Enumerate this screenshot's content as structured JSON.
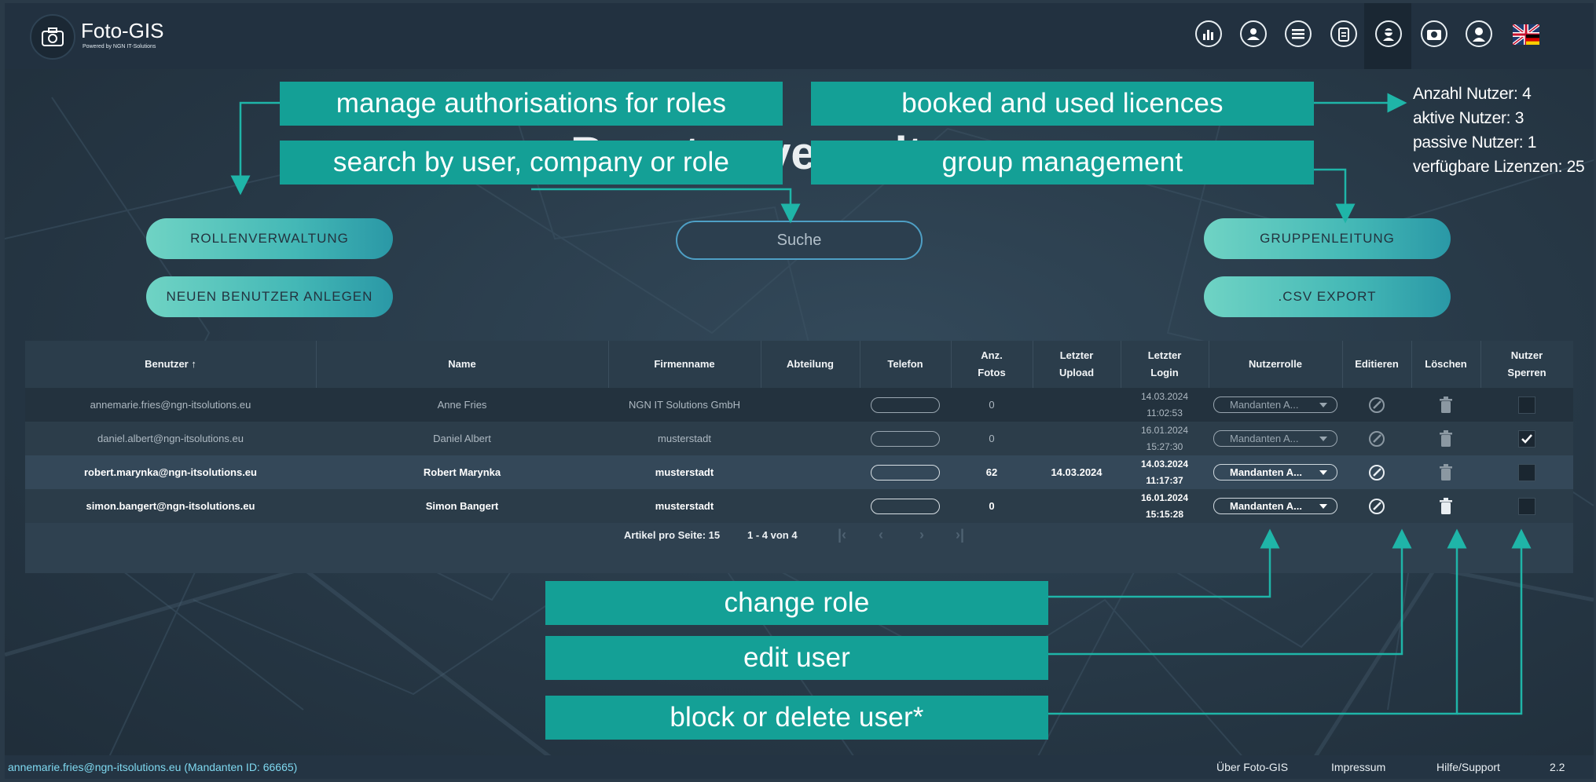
{
  "app": {
    "title": "Foto-GIS",
    "subtitle": "Powered by NGN IT-Solutions"
  },
  "nav": {
    "icons": [
      "statistics-icon",
      "map-user-icon",
      "list-icon",
      "clipboard-icon",
      "user-admin-icon",
      "camera-settings-icon",
      "profile-icon",
      "language-flag-icon"
    ]
  },
  "page": {
    "title": "Benutzerverwaltung"
  },
  "licences": {
    "line1": "Anzahl Nutzer: 4",
    "line2": "aktive Nutzer: 3",
    "line3": "passive Nutzer: 1",
    "line4": "verfügbare Lizenzen: 25"
  },
  "buttons": {
    "roles": "ROLLENVERWALTUNG",
    "new_user": "NEUEN BENUTZER ANLEGEN",
    "groups": "GRUPPENLEITUNG",
    "csv": ".CSV EXPORT"
  },
  "search": {
    "placeholder": "Suche"
  },
  "callouts": {
    "roles": "manage authorisations for roles",
    "search": "search by user, company or role",
    "licences": "booked and used licences",
    "groups": "group management",
    "change_role": "change role",
    "edit_user": "edit user",
    "block_delete": "block or delete user*"
  },
  "table": {
    "headers": {
      "user": "Benutzer",
      "sort_arrow": "↑",
      "name": "Name",
      "company": "Firmenname",
      "department": "Abteilung",
      "phone": "Telefon",
      "photos_1": "Anz.",
      "photos_2": "Fotos",
      "upload_1": "Letzter",
      "upload_2": "Upload",
      "login_1": "Letzter",
      "login_2": "Login",
      "role": "Nutzerrolle",
      "edit": "Editieren",
      "delete": "Löschen",
      "block_1": "Nutzer",
      "block_2": "Sperren"
    },
    "rows": [
      {
        "email": "annemarie.fries@ngn-itsolutions.eu",
        "name": "Anne Fries",
        "company": "NGN IT Solutions GmbH",
        "department": "",
        "photos": "0",
        "upload": "",
        "login_date": "14.03.2024",
        "login_time": "11:02:53",
        "role": "Mandanten A...",
        "blocked": false
      },
      {
        "email": "daniel.albert@ngn-itsolutions.eu",
        "name": "Daniel Albert",
        "company": "musterstadt",
        "department": "",
        "photos": "0",
        "upload": "",
        "login_date": "16.01.2024",
        "login_time": "15:27:30",
        "role": "Mandanten A...",
        "blocked": true
      },
      {
        "email": "robert.marynka@ngn-itsolutions.eu",
        "name": "Robert Marynka",
        "company": "musterstadt",
        "department": "",
        "photos": "62",
        "upload": "14.03.2024",
        "login_date": "14.03.2024",
        "login_time": "11:17:37",
        "role": "Mandanten A...",
        "blocked": false
      },
      {
        "email": "simon.bangert@ngn-itsolutions.eu",
        "name": "Simon Bangert",
        "company": "musterstadt",
        "department": "",
        "photos": "0",
        "upload": "",
        "login_date": "16.01.2024",
        "login_time": "15:15:28",
        "role": "Mandanten A...",
        "blocked": false
      }
    ],
    "pager": {
      "per_page": "Artikel pro Seite: 15",
      "range": "1 - 4 von 4"
    }
  },
  "footer": {
    "user": "annemarie.fries@ngn-itsolutions.eu (Mandanten ID: 66665)",
    "about": "Über Foto-GIS",
    "imprint": "Impressum",
    "help": "Hilfe/Support",
    "version": "2.2"
  },
  "colors": {
    "accent": "#14a096",
    "button_gradient_start": "#6fd3c4",
    "button_gradient_end": "#2a98a6",
    "background": "#273846"
  }
}
